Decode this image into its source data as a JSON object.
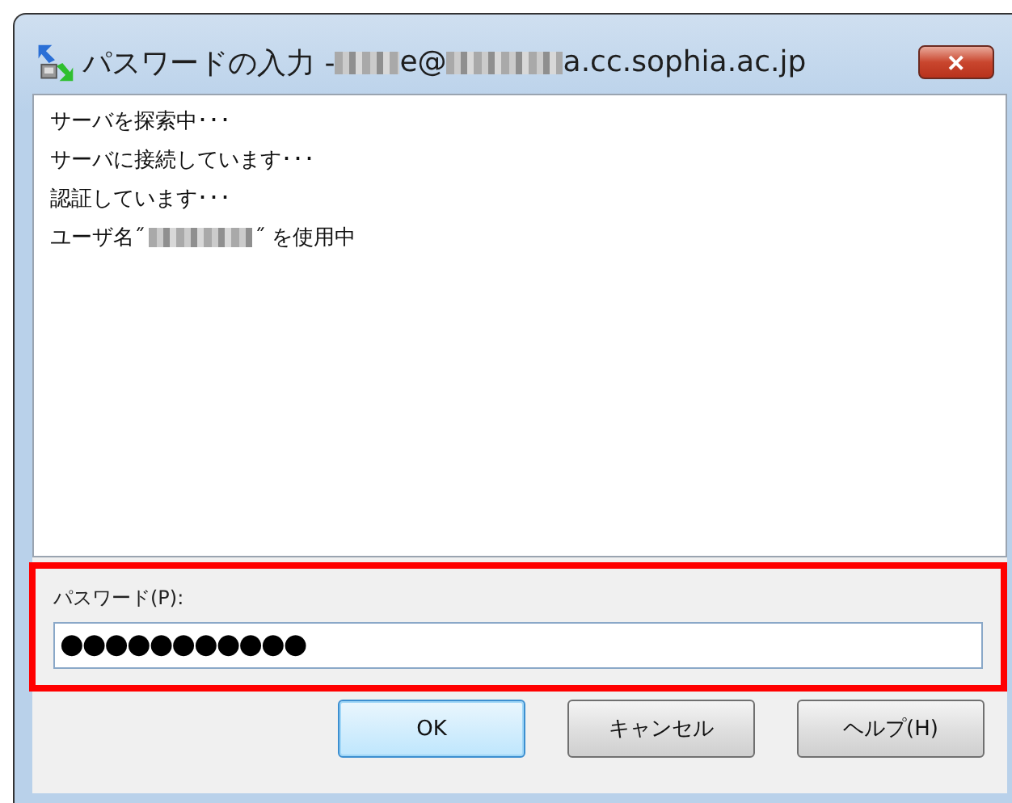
{
  "window": {
    "title_parts": [
      {
        "kind": "text",
        "text": "パスワードの入力 - "
      },
      {
        "kind": "redacted"
      },
      {
        "kind": "text",
        "text": "e@"
      },
      {
        "kind": "redacted"
      },
      {
        "kind": "text",
        "text": "a.cc.sophia.ac.jp"
      }
    ],
    "close": "✕"
  },
  "log": [
    [
      {
        "kind": "text",
        "text": "サーバを探索中･･･"
      }
    ],
    [
      {
        "kind": "text",
        "text": "サーバに接続しています･･･"
      }
    ],
    [
      {
        "kind": "text",
        "text": "認証しています･･･"
      }
    ],
    [
      {
        "kind": "text",
        "text": "ユーザ名˝"
      },
      {
        "kind": "redacted"
      },
      {
        "kind": "text",
        "text": "˝ を使用中"
      }
    ]
  ],
  "password": {
    "label": "パスワード(P):",
    "value": "●●●●●●●●●●●",
    "highlighted": true
  },
  "buttons": [
    {
      "label": "OK",
      "default": true
    },
    {
      "label": "キャンセル",
      "default": false
    },
    {
      "label": "ヘルプ(H)",
      "default": false
    }
  ]
}
